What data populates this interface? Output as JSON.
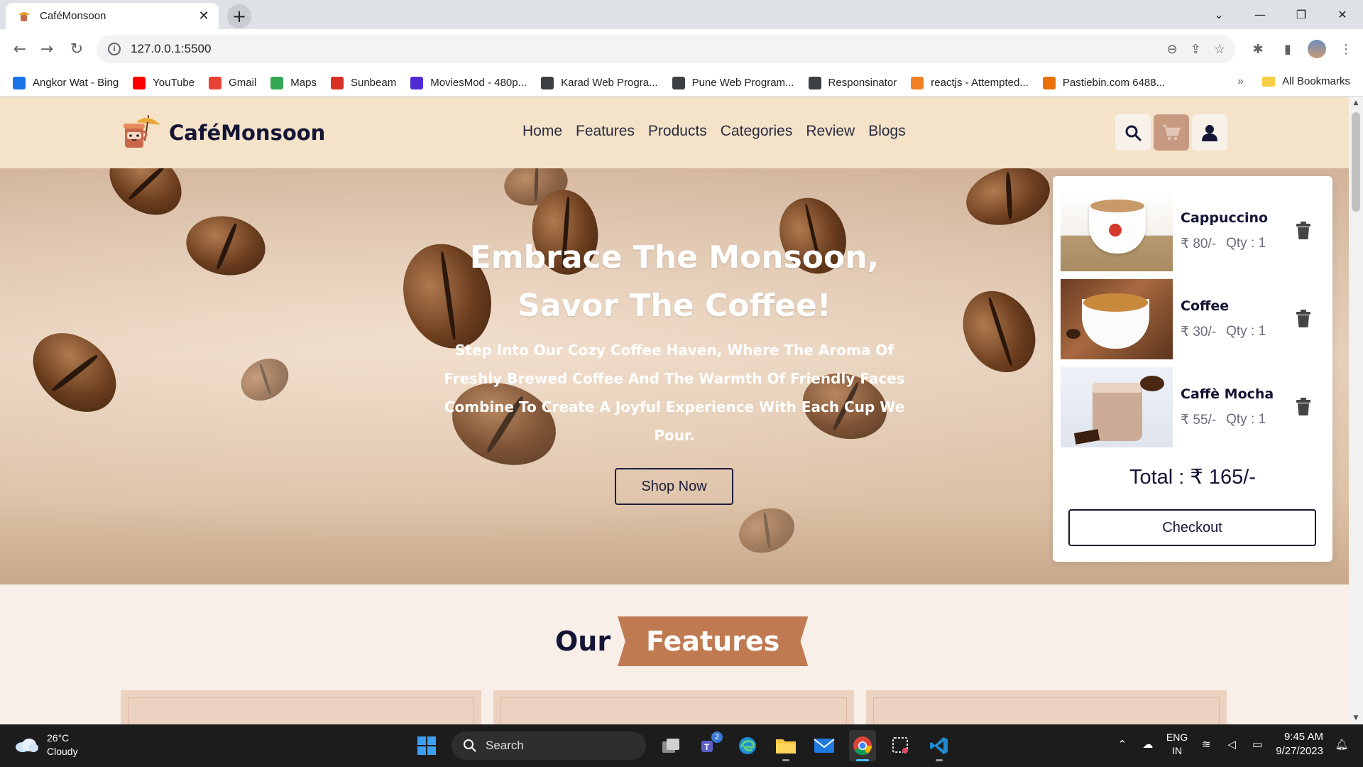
{
  "browser": {
    "tab_title": "CaféMonsoon",
    "url": "127.0.0.1:5500",
    "bookmarks": [
      {
        "label": "Angkor Wat - Bing",
        "icon": "bing-icon",
        "color": "#1a73e8"
      },
      {
        "label": "YouTube",
        "icon": "youtube-icon",
        "color": "#ff0000"
      },
      {
        "label": "Gmail",
        "icon": "gmail-icon",
        "color": "#ea4335"
      },
      {
        "label": "Maps",
        "icon": "maps-icon",
        "color": "#34a853"
      },
      {
        "label": "Sunbeam",
        "icon": "sunbeam-icon",
        "color": "#d93025"
      },
      {
        "label": "MoviesMod - 480p...",
        "icon": "moviesmod-icon",
        "color": "#4f2bd6"
      },
      {
        "label": "Karad Web Progra...",
        "icon": "globe-icon",
        "color": "#3c4043"
      },
      {
        "label": "Pune Web Program...",
        "icon": "globe-icon",
        "color": "#3c4043"
      },
      {
        "label": "Responsinator",
        "icon": "responsinator-icon",
        "color": "#3c4043"
      },
      {
        "label": "reactjs - Attempted...",
        "icon": "stackoverflow-icon",
        "color": "#f48024"
      },
      {
        "label": "Pastiebin.com 6488...",
        "icon": "pastiebin-icon",
        "color": "#e8710a"
      }
    ],
    "all_bookmarks": "All Bookmarks"
  },
  "site": {
    "brand": "CaféMonsoon",
    "nav": [
      "Home",
      "Features",
      "Products",
      "Categories",
      "Review",
      "Blogs"
    ],
    "hero": {
      "title_line1": "Embrace The Monsoon,",
      "title_line2": "Savor The Coffee!",
      "subtitle": "Step Into Our Cozy Coffee Haven, Where The Aroma Of Freshly Brewed Coffee And The Warmth Of Friendly Faces Combine To Create A Joyful Experience With Each Cup We Pour.",
      "cta": "Shop Now"
    },
    "cart": {
      "items": [
        {
          "name": "Cappuccino",
          "price": "₹ 80/-",
          "qty": "Qty : 1"
        },
        {
          "name": "Coffee",
          "price": "₹ 30/-",
          "qty": "Qty : 1"
        },
        {
          "name": "Caffè Mocha",
          "price": "₹ 55/-",
          "qty": "Qty : 1"
        }
      ],
      "total": "Total : ₹ 165/-",
      "checkout": "Checkout"
    },
    "features": {
      "title_a": "Our",
      "title_b": "Features"
    },
    "colors": {
      "header_bg": "#f4e3c9",
      "accent": "#c07a52",
      "navy": "#141536"
    }
  },
  "taskbar": {
    "weather_temp": "26°C",
    "weather_desc": "Cloudy",
    "search": "Search",
    "lang_1": "ENG",
    "lang_2": "IN",
    "time": "9:45 AM",
    "date": "9/27/2023",
    "teams_badge": "2"
  }
}
